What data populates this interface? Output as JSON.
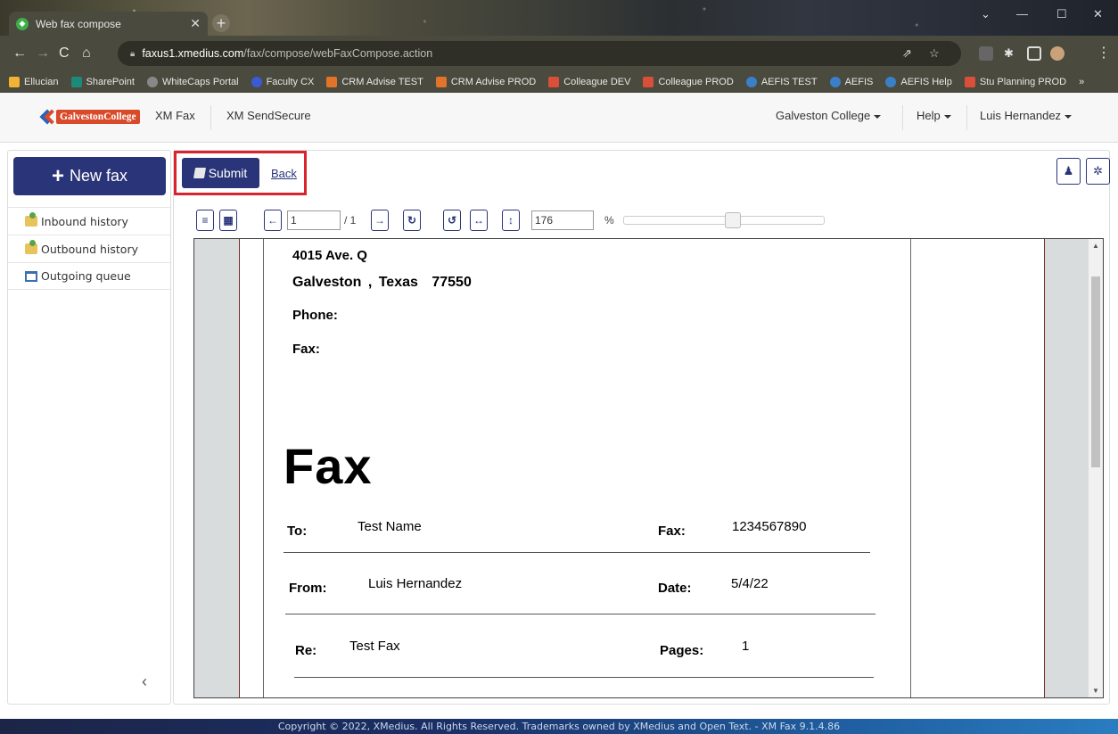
{
  "browser": {
    "tab_title": "Web fax compose",
    "url_host": "faxus1.xmedius.com",
    "url_path": "/fax/compose/webFaxCompose.action",
    "bookmarks": [
      {
        "label": "Ellucian",
        "color": "#f2b233"
      },
      {
        "label": "SharePoint",
        "color": "#1b8a7a"
      },
      {
        "label": "WhiteCaps Portal",
        "color": "#888888"
      },
      {
        "label": "Faculty CX",
        "color": "#3b5bd6"
      },
      {
        "label": "CRM Advise TEST",
        "color": "#e2732b"
      },
      {
        "label": "CRM Advise PROD",
        "color": "#e2732b"
      },
      {
        "label": "Colleague DEV",
        "color": "#d94f3a"
      },
      {
        "label": "Colleague PROD",
        "color": "#d94f3a"
      },
      {
        "label": "AEFIS TEST",
        "color": "#3a80c9"
      },
      {
        "label": "AEFIS",
        "color": "#3a80c9"
      },
      {
        "label": "AEFIS Help",
        "color": "#3a80c9"
      },
      {
        "label": "Stu Planning PROD",
        "color": "#d94f3a"
      }
    ],
    "more_bookmarks": "»"
  },
  "header": {
    "logo_text": "GalvestonCollege",
    "nav": [
      "XM Fax",
      "XM SendSecure"
    ],
    "org_menu": "Galveston College",
    "help_menu": "Help",
    "user_menu": "Luis Hernandez"
  },
  "sidebar": {
    "new_fax_label": "New fax",
    "items": [
      {
        "label": "Inbound history",
        "icon": "folder-icon"
      },
      {
        "label": "Outbound history",
        "icon": "folder-icon"
      },
      {
        "label": "Outgoing queue",
        "icon": "outbox-icon"
      }
    ],
    "collapse_label": "‹"
  },
  "toolbar": {
    "submit_label": "Submit",
    "back_label": "Back"
  },
  "viewer": {
    "page_value": "1",
    "page_total": "/ 1",
    "zoom_value": "176",
    "zoom_unit": "%",
    "zoom_slider_fraction": 0.55
  },
  "document": {
    "address_line1": "4015 Ave. Q",
    "city": "Galveston",
    "comma": ",",
    "state": "Texas",
    "zip": "77550",
    "phone_label": "Phone:",
    "fax_line_label": "Fax:",
    "title": "Fax",
    "to_label": "To:",
    "to_value": "Test Name",
    "fax_label": "Fax:",
    "fax_value": "1234567890",
    "from_label": "From:",
    "from_value": "Luis Hernandez",
    "date_label": "Date:",
    "date_value": "5/4/22",
    "re_label": "Re:",
    "re_value": "Test Fax",
    "pages_label": "Pages:",
    "pages_value": "1"
  },
  "footer": {
    "text": "Copyright © 2022, XMedius. All Rights Reserved. Trademarks owned by XMedius and Open Text. - XM Fax 9.1.4.86"
  },
  "colors": {
    "primary": "#2a3579",
    "highlight": "#d9232e",
    "logo_red": "#d84a2a"
  }
}
